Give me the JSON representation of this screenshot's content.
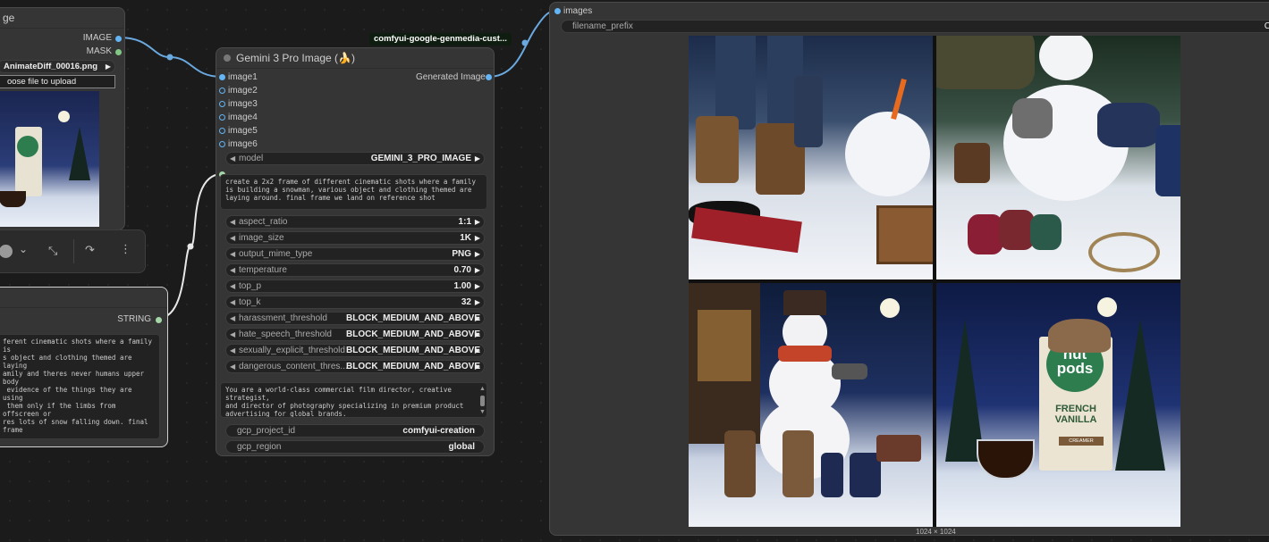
{
  "load_node": {
    "title_fragment": "ge",
    "out_image": "IMAGE",
    "out_mask": "MASK",
    "filename": "AnimateDiff_00016.png",
    "upload_label": "oose file to upload"
  },
  "toolbar": {
    "icons": [
      "color-circle-icon",
      "chevron-down-icon",
      "collapse-icon",
      "redo-icon",
      "more-icon"
    ]
  },
  "string_node": {
    "out_string": "STRING",
    "text": "ferent cinematic shots where a family is\ns object and clothing themed are laying\namily and theres never humans upper body\n evidence of the things they are using\n them only if the limbs from offscreen or\nres lots of snow falling down. final frame"
  },
  "gemini_node": {
    "badge": "comfyui-google-genmedia-cust...",
    "title": "Gemini 3 Pro Image (🍌)",
    "inputs": [
      "image1",
      "image2",
      "image3",
      "image4",
      "image5",
      "image6"
    ],
    "output": "Generated Image",
    "model_label": "model",
    "model_value": "GEMINI_3_PRO_IMAGE",
    "prompt": "create a 2x2 frame of different cinematic shots where a family is building a snowman, various object and clothing themed are laying around. final frame we land on reference shot",
    "params": [
      {
        "label": "aspect_ratio",
        "value": "1:1"
      },
      {
        "label": "image_size",
        "value": "1K"
      },
      {
        "label": "output_mime_type",
        "value": "PNG"
      },
      {
        "label": "temperature",
        "value": "0.70"
      },
      {
        "label": "top_p",
        "value": "1.00"
      },
      {
        "label": "top_k",
        "value": "32"
      },
      {
        "label": "harassment_threshold",
        "value": "BLOCK_MEDIUM_AND_ABOVE"
      },
      {
        "label": "hate_speech_threshold",
        "value": "BLOCK_MEDIUM_AND_ABOVE"
      },
      {
        "label": "sexually_explicit_threshold",
        "value": "BLOCK_MEDIUM_AND_ABOVE"
      },
      {
        "label": "dangerous_content_thres...",
        "value": "BLOCK_MEDIUM_AND_ABOVE"
      }
    ],
    "system_prompt": "You are a world-class commercial film director, creative strategist,\nand director of photography specializing in premium product\nadvertising for global brands.\nYou think in story, emotion, lighting, camera movement, and",
    "project_label": "gcp_project_id",
    "project_value": "comfyui-creation",
    "region_label": "gcp_region",
    "region_value": "global"
  },
  "preview_node": {
    "input": "images",
    "filename_label": "filename_prefix",
    "filename_value": "C",
    "dims": "1024 × 1024"
  },
  "product": {
    "brand_top": "nut",
    "brand_bottom": "pods",
    "flavor_1": "FRENCH",
    "flavor_2": "VANILLA",
    "sub": "CREAMER"
  },
  "colors": {
    "image_pin": "#64b5f6",
    "mask_pin": "#81c784",
    "string_pin": "#a5d6a7",
    "badge_bg": "#0f1d10"
  }
}
